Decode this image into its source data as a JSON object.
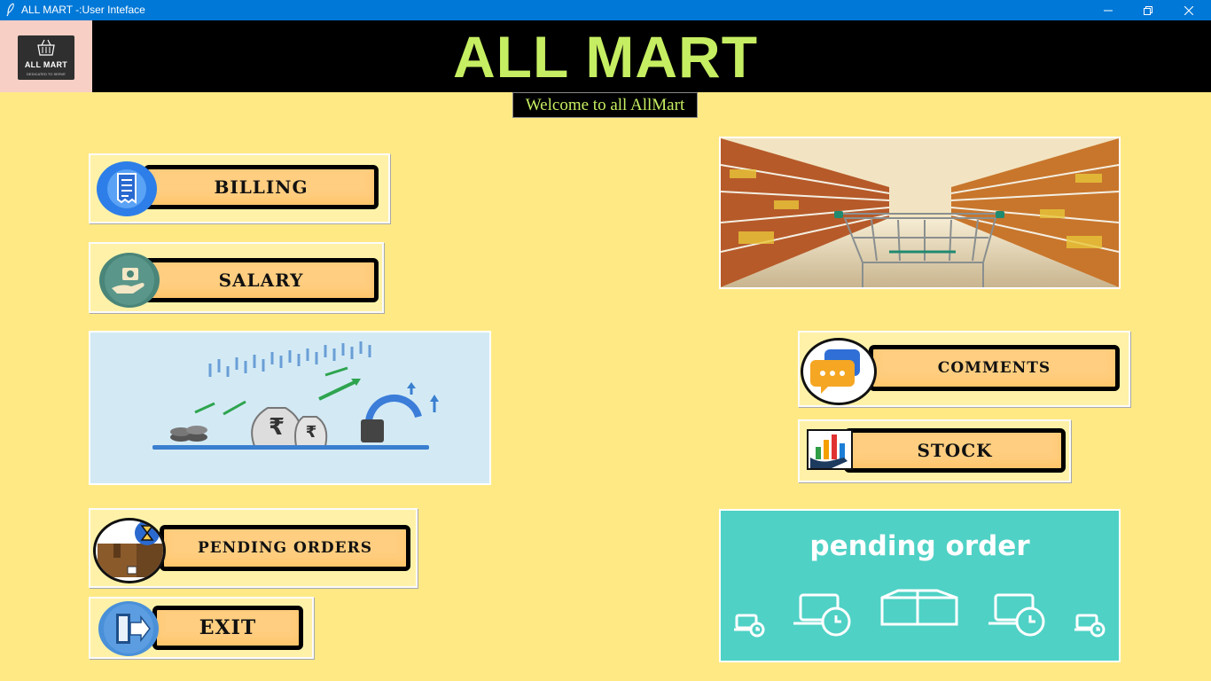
{
  "window": {
    "title": "ALL MART -:User Inteface",
    "controls": {
      "minimize": "minimize-icon",
      "maximize": "restore-icon",
      "close": "close-icon"
    }
  },
  "logo": {
    "name": "ALL MART",
    "tagline": "DEDICATED TO SERVE"
  },
  "header": {
    "title": "ALL MART",
    "welcome": "Welcome to all AllMart"
  },
  "buttons": {
    "billing": "BILLING",
    "salary": "SALARY",
    "pending_orders": "PENDING ORDERS",
    "exit": "EXIT",
    "comments": "COMMENTS",
    "stock": "STOCK"
  },
  "banners": {
    "pending_order": "pending order"
  },
  "colors": {
    "background": "#ffe985",
    "header_bg": "#000000",
    "title_green": "#c6ee62",
    "button_fill": "#ffce80",
    "teal_banner": "#4fd1c5",
    "titlebar": "#0078d7"
  }
}
